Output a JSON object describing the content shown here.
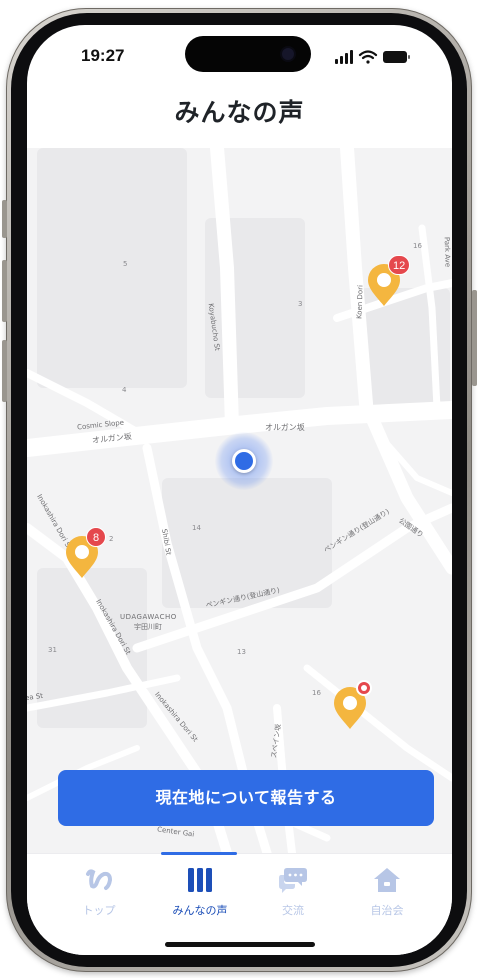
{
  "status": {
    "time": "19:27"
  },
  "header": {
    "title": "みんなの声"
  },
  "map": {
    "street_labels": [
      "Cosmic Slope",
      "オルガン坂",
      "オルガン坂",
      "Koyabucho St",
      "Koen Dori",
      "Park Ave",
      "Inokashira Dori St",
      "Inokashira Dori St",
      "Inokashira Dori St",
      "ペンギン通り(登山通り)",
      "ペンギン通り(登山通り)",
      "公園通り",
      "スペイン坂",
      "UDAGAWACHO",
      "宇田川町",
      "ea St",
      "Shibi St",
      "Center Gai"
    ],
    "block_numbers": [
      "5",
      "3",
      "4",
      "16",
      "14",
      "2",
      "31",
      "13",
      "16"
    ],
    "pins": [
      {
        "label": "12",
        "color": "#F4B63F"
      },
      {
        "label": "8",
        "color": "#F4B63F"
      },
      {
        "label": "",
        "color": "#F4B63F"
      }
    ],
    "current_location_color": "#2F6CE5"
  },
  "actions": {
    "report_button": "現在地について報告する"
  },
  "tabbar": {
    "tabs": [
      {
        "label": "トップ",
        "icon": "logo-icon",
        "active": false
      },
      {
        "label": "みんなの声",
        "icon": "voices-icon",
        "active": true
      },
      {
        "label": "交流",
        "icon": "chat-icon",
        "active": false
      },
      {
        "label": "自治会",
        "icon": "house-icon",
        "active": false
      }
    ]
  },
  "colors": {
    "accent": "#2F6CE5",
    "inactive": "#B7C6E6",
    "badge": "#E5484D",
    "pin": "#F4B63F"
  }
}
